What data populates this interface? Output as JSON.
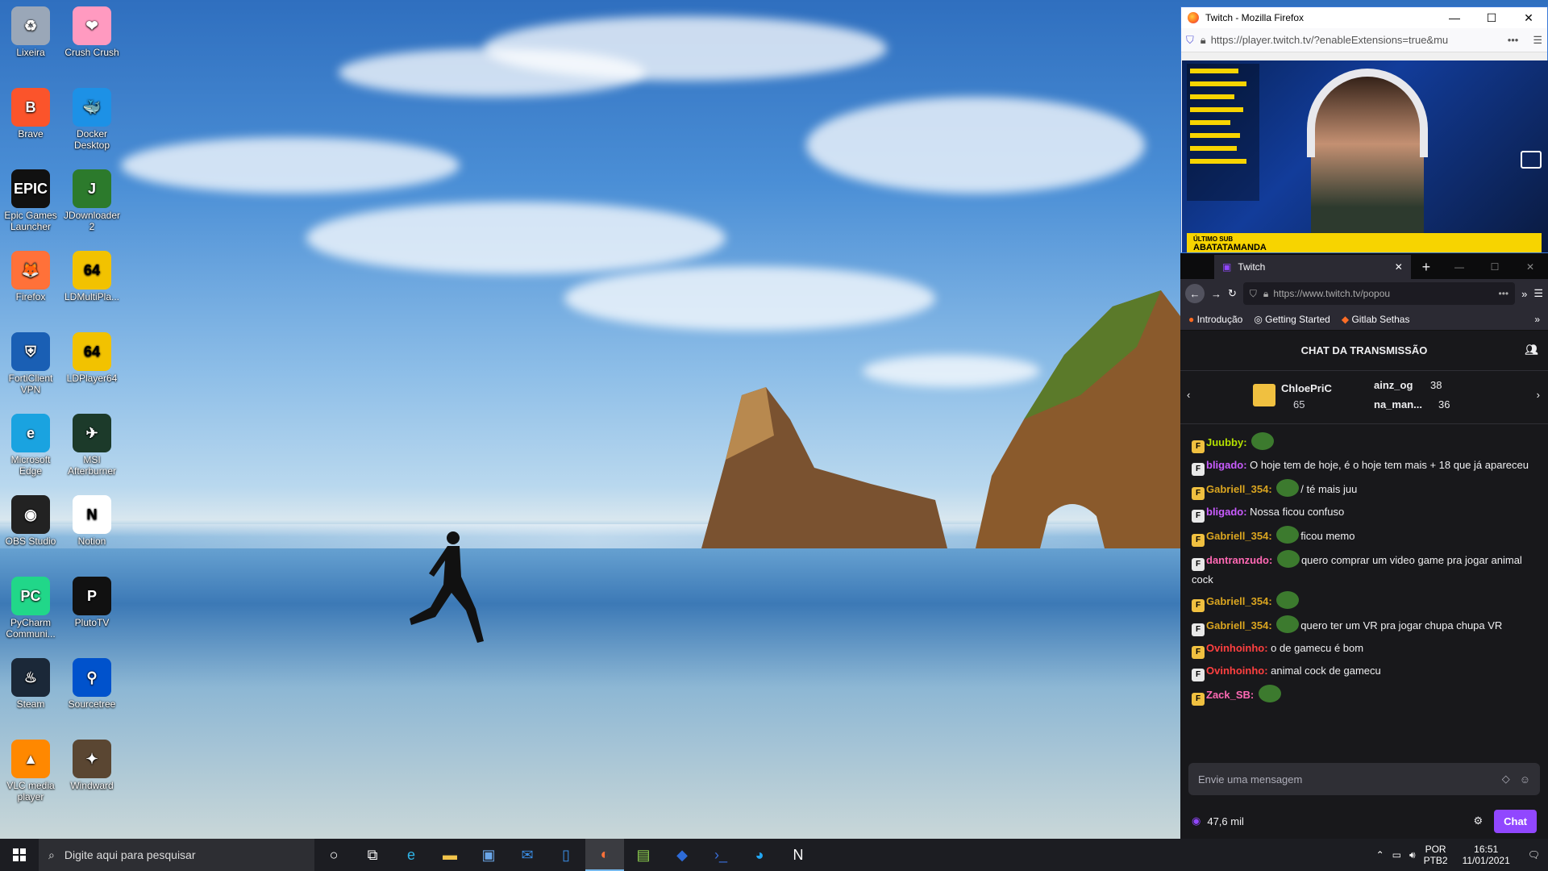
{
  "desktop_icons": [
    {
      "label": "Lixeira",
      "icon": "recycle-bin-icon"
    },
    {
      "label": "Crush Crush",
      "icon": "crush-crush-icon"
    },
    {
      "label": "Brave",
      "icon": "brave-icon"
    },
    {
      "label": "Docker Desktop",
      "icon": "docker-icon"
    },
    {
      "label": "Epic Games Launcher",
      "icon": "epic-games-icon"
    },
    {
      "label": "JDownloader 2",
      "icon": "jdownloader-icon"
    },
    {
      "label": "Firefox",
      "icon": "firefox-icon"
    },
    {
      "label": "LDMultiPla...",
      "icon": "ldmultiplayer-icon"
    },
    {
      "label": "FortiClient VPN",
      "icon": "forticlient-icon"
    },
    {
      "label": "LDPlayer64",
      "icon": "ldplayer-icon"
    },
    {
      "label": "Microsoft Edge",
      "icon": "edge-icon"
    },
    {
      "label": "MSI Afterburner",
      "icon": "msi-afterburner-icon"
    },
    {
      "label": "OBS Studio",
      "icon": "obs-icon"
    },
    {
      "label": "Notion",
      "icon": "notion-icon"
    },
    {
      "label": "PyCharm Communi...",
      "icon": "pycharm-icon"
    },
    {
      "label": "PlutoTV",
      "icon": "plutotv-icon"
    },
    {
      "label": "Steam",
      "icon": "steam-icon"
    },
    {
      "label": "Sourcetree",
      "icon": "sourcetree-icon"
    },
    {
      "label": "VLC media player",
      "icon": "vlc-icon"
    },
    {
      "label": "Windward",
      "icon": "windward-icon"
    }
  ],
  "window1": {
    "title": "Twitch - Mozilla Firefox",
    "url": "https://player.twitch.tv/?enableExtensions=true&mu",
    "video_overlay_label": "ÚLTIMO SUB",
    "video_overlay_name": "ABATATAMANDA"
  },
  "window2": {
    "tab_title": "Twitch",
    "url": "https://www.twitch.tv/popou",
    "bookmarks": [
      "Introdução",
      "Getting Started",
      "Gitlab Sethas"
    ],
    "chat_header": "CHAT DA TRANSMISSÃO",
    "leaderboard": {
      "top": {
        "name": "ChloePriC",
        "count": "65"
      },
      "second": {
        "name": "ainz_og",
        "count": "38"
      },
      "third": {
        "name": "na_man...",
        "count": "36"
      }
    },
    "messages": [
      {
        "user": "Juubby:",
        "color": "#b4e000",
        "text": ""
      },
      {
        "user": "bligado:",
        "color": "#c95cff",
        "text": "O hoje tem de hoje, é o hoje tem mais + 18 que já apareceu"
      },
      {
        "user": "Gabriell_354:",
        "color": "#daa520",
        "text": "/ té mais juu"
      },
      {
        "user": "bligado:",
        "color": "#c95cff",
        "text": "Nossa ficou confuso"
      },
      {
        "user": "Gabriell_354:",
        "color": "#daa520",
        "text": "ficou memo"
      },
      {
        "user": "dantranzudo:",
        "color": "#ff69b4",
        "text": "quero comprar um video game pra jogar animal cock"
      },
      {
        "user": "Gabriell_354:",
        "color": "#daa520",
        "text": ""
      },
      {
        "user": "Gabriell_354:",
        "color": "#daa520",
        "text": "quero ter um VR pra jogar chupa chupa VR"
      },
      {
        "user": "Ovinhoinho:",
        "color": "#ff4040",
        "text": "o de gamecu é bom"
      },
      {
        "user": "Ovinhoinho:",
        "color": "#ff4040",
        "text": "animal cock de gamecu"
      },
      {
        "user": "Zack_SB:",
        "color": "#ff69b4",
        "text": ""
      }
    ],
    "input_placeholder": "Envie uma mensagem",
    "viewers": "47,6 mil",
    "chat_button": "Chat"
  },
  "taskbar": {
    "search_placeholder": "Digite aqui para pesquisar",
    "apps": [
      "cortana-icon",
      "task-view-icon",
      "edge-icon",
      "file-explorer-icon",
      "store-icon",
      "mail-icon",
      "phone-icon",
      "firefox-icon",
      "notepad-icon",
      "teams-icon",
      "powershell-icon",
      "messenger-icon",
      "notion-icon"
    ],
    "lang": "POR",
    "layout": "PTB2",
    "time": "16:51",
    "date": "11/01/2021"
  }
}
